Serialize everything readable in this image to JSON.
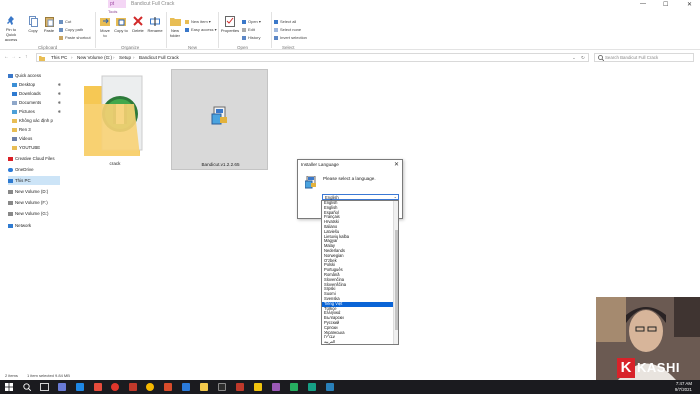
{
  "titlebar": {
    "manage_tab": "pt",
    "title": "Bandicut Full Crack",
    "minimize": "—",
    "maximize": "☐",
    "close": "✕"
  },
  "ribbon": {
    "tools_label": "Tools",
    "clipboard": {
      "pin_label": "Pin to Quick access",
      "copy_label": "Copy",
      "paste_label": "Paste",
      "cut_label": "Cut",
      "copy_path_label": "Copy path",
      "paste_shortcut_label": "Paste shortcut",
      "group_label": "Clipboard"
    },
    "organize": {
      "move_to_label": "Move to",
      "copy_to_label": "Copy to",
      "delete_label": "Delete",
      "rename_label": "Rename",
      "group_label": "Organize"
    },
    "new": {
      "new_folder_label": "New folder",
      "new_item_label": "New item",
      "easy_access_label": "Easy access",
      "group_label": "New"
    },
    "open": {
      "properties_label": "Properties",
      "open_label": "Open",
      "edit_label": "Edit",
      "history_label": "History",
      "group_label": "Open"
    },
    "select": {
      "select_all_label": "Select all",
      "select_none_label": "Select none",
      "invert_label": "Invert selection",
      "group_label": "Select"
    }
  },
  "address": {
    "crumbs": [
      "This PC",
      "New Volume (G:)",
      "Setup",
      "Bandicut Full Crack"
    ],
    "search_placeholder": "Search Bandicut Full Crack"
  },
  "nav": {
    "items": [
      {
        "label": "Quick access"
      },
      {
        "label": "Desktop"
      },
      {
        "label": "Downloads"
      },
      {
        "label": "Documents"
      },
      {
        "label": "Pictures"
      },
      {
        "label": "Không xác định p"
      },
      {
        "label": "Ren 3"
      },
      {
        "label": "Videos"
      },
      {
        "label": "YOUTUBE"
      },
      {
        "label": "Creative Cloud Files"
      },
      {
        "label": "OneDrive"
      },
      {
        "label": "This PC"
      },
      {
        "label": "New Volume (D:)"
      },
      {
        "label": "New Volume (F:)"
      },
      {
        "label": "New Volume (G:)"
      },
      {
        "label": "Network"
      }
    ]
  },
  "files": [
    {
      "name": "crack"
    },
    {
      "name": "Bandicut.v1.2.2.65"
    }
  ],
  "status": {
    "items_count": "2 items",
    "selection": "1 item selected 9.84 MB"
  },
  "dialog": {
    "title": "Installer Language",
    "close": "✕",
    "prompt": "Please select a language.",
    "selected_value": "English",
    "dropdown_arrow": "⌄",
    "options": [
      "English",
      "English",
      "Español",
      "Français",
      "Hrvatski",
      "Italiano",
      "Latviešu",
      "Lietuvių kalba",
      "Magyar",
      "Malay",
      "Nederlands",
      "Norwegian",
      "O'zbek",
      "Polski",
      "Português",
      "Română",
      "Slovenčina",
      "Slovenščina",
      "Srpski",
      "Suomi",
      "Svenska",
      "Tiếng Việt",
      "Türkçe",
      "Ελληνικά",
      "Български",
      "Русский",
      "Српски",
      "Українська",
      "עברית",
      "العربية",
      "فارسی"
    ],
    "highlighted_index": 21
  },
  "overlay": {
    "logo_letter": "K",
    "logo_text": "KASHI"
  },
  "taskbar": {
    "time": "7:47 AM",
    "date": "9/7/2021"
  }
}
